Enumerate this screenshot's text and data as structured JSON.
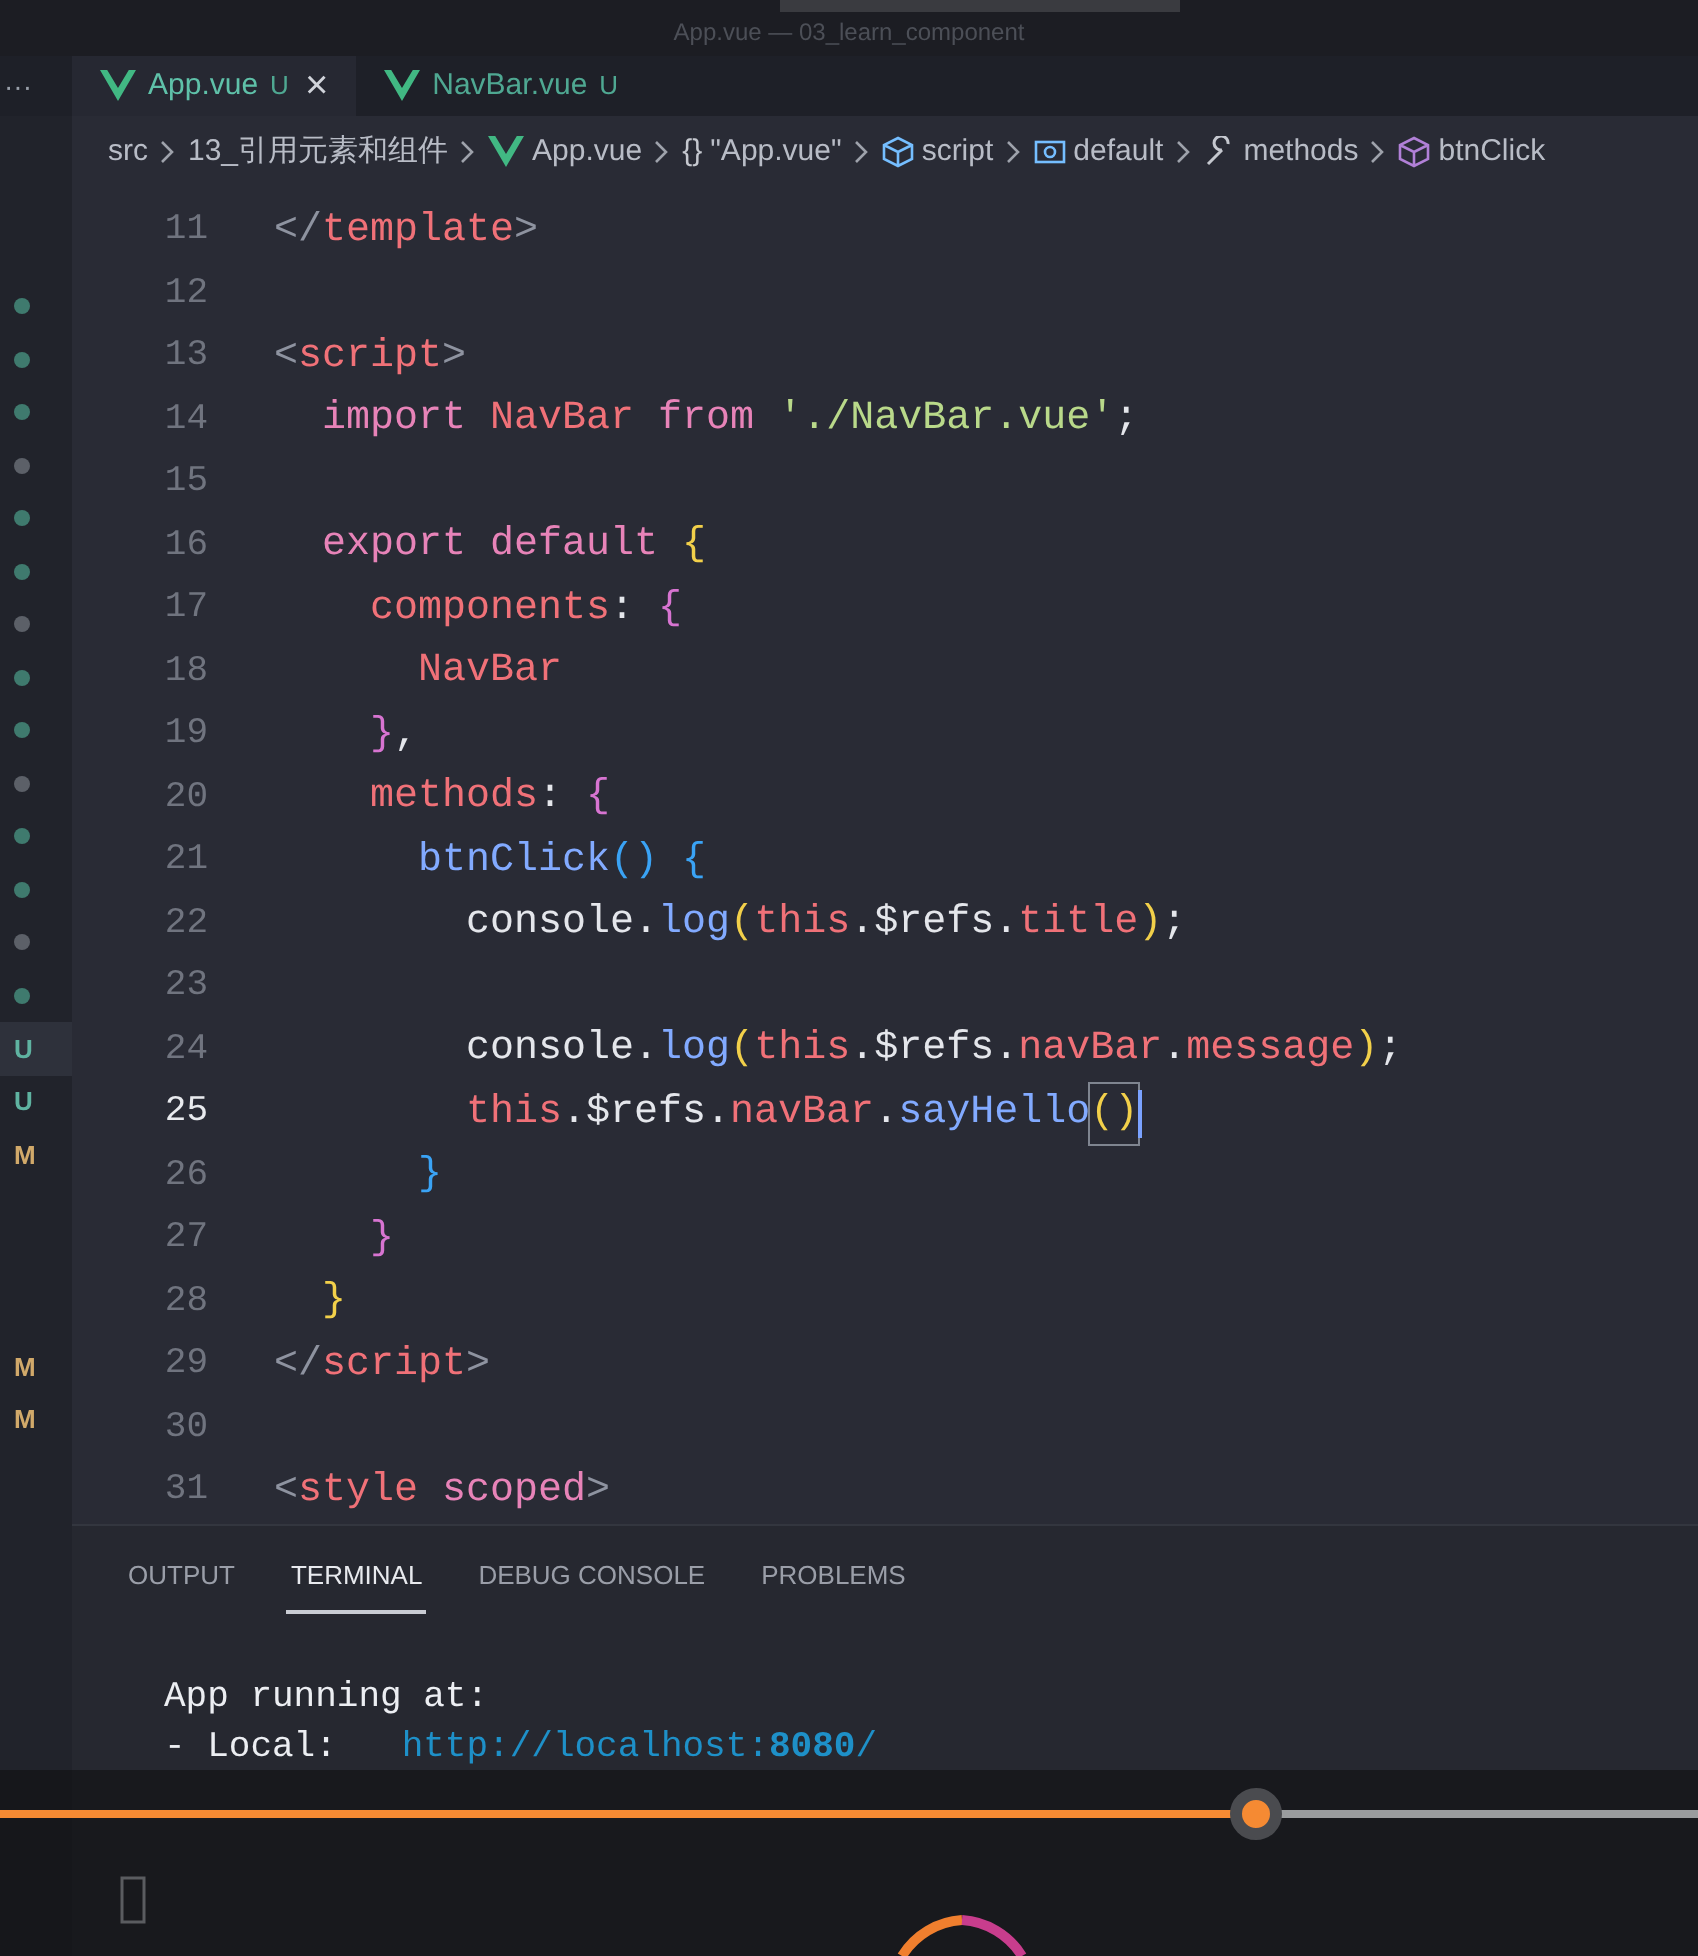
{
  "window": {
    "title": "App.vue — 03_learn_component"
  },
  "sidebar": {
    "more": "···",
    "decorations": [
      {
        "kind": "dot",
        "color": "#3f7a6e"
      },
      {
        "kind": "dot",
        "color": "#3f7a6e"
      },
      {
        "kind": "dot",
        "color": "#3f7a6e"
      },
      {
        "kind": "dot",
        "color": "#5c6068"
      },
      {
        "kind": "dot",
        "color": "#3f7a6e"
      },
      {
        "kind": "dot",
        "color": "#3f7a6e"
      },
      {
        "kind": "dot",
        "color": "#5c6068"
      },
      {
        "kind": "dot",
        "color": "#3f7a6e"
      },
      {
        "kind": "dot",
        "color": "#3f7a6e"
      },
      {
        "kind": "dot",
        "color": "#5c6068"
      },
      {
        "kind": "dot",
        "color": "#3f7a6e"
      },
      {
        "kind": "dot",
        "color": "#3f7a6e"
      },
      {
        "kind": "dot",
        "color": "#5c6068"
      },
      {
        "kind": "dot",
        "color": "#3f7a6e"
      },
      {
        "kind": "letter",
        "text": "U",
        "color": "#5fb3a1",
        "selected": true
      },
      {
        "kind": "letter",
        "text": "U",
        "color": "#5fb3a1",
        "selected": false
      },
      {
        "kind": "letter",
        "text": "M",
        "color": "#d1a96a",
        "selected": false
      },
      {
        "kind": "blank"
      },
      {
        "kind": "blank"
      },
      {
        "kind": "blank"
      },
      {
        "kind": "letter",
        "text": "M",
        "color": "#d1a96a",
        "selected": false
      },
      {
        "kind": "letter",
        "text": "M",
        "color": "#d1a96a",
        "selected": false
      }
    ]
  },
  "tabs": [
    {
      "label": "App.vue",
      "status": "U",
      "selected": true,
      "close": "×"
    },
    {
      "label": "NavBar.vue",
      "status": "U",
      "selected": false
    }
  ],
  "breadcrumb": [
    {
      "kind": "folder",
      "label": "src"
    },
    {
      "kind": "folder",
      "label": "13_引用元素和组件"
    },
    {
      "kind": "vue",
      "label": "App.vue"
    },
    {
      "kind": "module",
      "glyph": "{}",
      "label": "\"App.vue\""
    },
    {
      "kind": "script",
      "label": "script"
    },
    {
      "kind": "variable",
      "label": "default"
    },
    {
      "kind": "method",
      "label": "methods"
    },
    {
      "kind": "function",
      "label": "btnClick"
    }
  ],
  "editor": {
    "lines": [
      {
        "number": "11",
        "current": false,
        "tokens": [
          {
            "text": "</",
            "kind": "punct"
          },
          {
            "text": "template",
            "kind": "tag"
          },
          {
            "text": ">",
            "kind": "punct"
          }
        ]
      },
      {
        "number": "12",
        "current": false
      },
      {
        "number": "13",
        "current": false,
        "tokens": [
          {
            "text": "<",
            "kind": "punct"
          },
          {
            "text": "script",
            "kind": "tag"
          },
          {
            "text": ">",
            "kind": "punct"
          }
        ]
      },
      {
        "number": "14",
        "current": false,
        "tokens": [
          {
            "text": "  import ",
            "kind": "kw"
          },
          {
            "text": "NavBar ",
            "kind": "ident"
          },
          {
            "text": "from ",
            "kind": "kw"
          },
          {
            "text": "'./NavBar.vue'",
            "kind": "str"
          },
          {
            "text": ";",
            "kind": "plain"
          }
        ]
      },
      {
        "number": "15",
        "current": false
      },
      {
        "number": "16",
        "current": false,
        "tokens": [
          {
            "text": "  export default ",
            "kind": "kw"
          },
          {
            "text": "{",
            "kind": "b1"
          }
        ]
      },
      {
        "number": "17",
        "current": false,
        "tokens": [
          {
            "text": "    components",
            "kind": "ident"
          },
          {
            "text": ": ",
            "kind": "plain"
          },
          {
            "text": "{",
            "kind": "b2"
          }
        ]
      },
      {
        "number": "18",
        "current": false,
        "tokens": [
          {
            "text": "      NavBar",
            "kind": "ident"
          }
        ]
      },
      {
        "number": "19",
        "current": false,
        "tokens": [
          {
            "text": "    }",
            "kind": "b2"
          },
          {
            "text": ",",
            "kind": "plain"
          }
        ]
      },
      {
        "number": "20",
        "current": false,
        "tokens": [
          {
            "text": "    methods",
            "kind": "ident"
          },
          {
            "text": ": ",
            "kind": "plain"
          },
          {
            "text": "{",
            "kind": "b2"
          }
        ]
      },
      {
        "number": "21",
        "current": false,
        "tokens": [
          {
            "text": "      btnClick",
            "kind": "fn"
          },
          {
            "text": "() {",
            "kind": "b3"
          }
        ]
      },
      {
        "number": "22",
        "current": false,
        "tokens": [
          {
            "text": "        console.",
            "kind": "plain"
          },
          {
            "text": "log",
            "kind": "fn"
          },
          {
            "text": "(",
            "kind": "b1"
          },
          {
            "text": "this",
            "kind": "ident"
          },
          {
            "text": ".$refs.",
            "kind": "plain"
          },
          {
            "text": "title",
            "kind": "ident"
          },
          {
            "text": ")",
            "kind": "b1"
          },
          {
            "text": ";",
            "kind": "plain"
          }
        ]
      },
      {
        "number": "23",
        "current": false
      },
      {
        "number": "24",
        "current": false,
        "tokens": [
          {
            "text": "        console.",
            "kind": "plain"
          },
          {
            "text": "log",
            "kind": "fn"
          },
          {
            "text": "(",
            "kind": "b1"
          },
          {
            "text": "this",
            "kind": "ident"
          },
          {
            "text": ".$refs.",
            "kind": "plain"
          },
          {
            "text": "navBar",
            "kind": "ident"
          },
          {
            "text": ".",
            "kind": "plain"
          },
          {
            "text": "message",
            "kind": "ident"
          },
          {
            "text": ")",
            "kind": "b1"
          },
          {
            "text": ";",
            "kind": "plain"
          }
        ]
      },
      {
        "number": "25",
        "current": true,
        "tokens": [
          {
            "text": "        this",
            "kind": "ident"
          },
          {
            "text": ".$refs.",
            "kind": "plain"
          },
          {
            "text": "navBar",
            "kind": "ident"
          },
          {
            "text": ".",
            "kind": "plain"
          },
          {
            "text": "sayHello",
            "kind": "fn"
          },
          {
            "text": "()",
            "kind": "match"
          }
        ]
      },
      {
        "number": "26",
        "current": false,
        "tokens": [
          {
            "text": "      }",
            "kind": "b3"
          }
        ]
      },
      {
        "number": "27",
        "current": false,
        "tokens": [
          {
            "text": "    }",
            "kind": "b2"
          }
        ]
      },
      {
        "number": "28",
        "current": false,
        "tokens": [
          {
            "text": "  }",
            "kind": "b1"
          }
        ]
      },
      {
        "number": "29",
        "current": false,
        "tokens": [
          {
            "text": "</",
            "kind": "punct"
          },
          {
            "text": "script",
            "kind": "tag"
          },
          {
            "text": ">",
            "kind": "punct"
          }
        ]
      },
      {
        "number": "30",
        "current": false
      },
      {
        "number": "31",
        "current": false,
        "tokens": [
          {
            "text": "<",
            "kind": "punct"
          },
          {
            "text": "style ",
            "kind": "tag"
          },
          {
            "text": "scoped",
            "kind": "kw"
          },
          {
            "text": ">",
            "kind": "punct"
          }
        ]
      }
    ]
  },
  "panel": {
    "tabs": [
      {
        "label": "OUTPUT",
        "selected": false
      },
      {
        "label": "TERMINAL",
        "selected": true
      },
      {
        "label": "DEBUG CONSOLE",
        "selected": false
      },
      {
        "label": "PROBLEMS",
        "selected": false
      }
    ],
    "terminal": [
      [
        {
          "text": "App running at:",
          "kind": "text"
        }
      ],
      [
        {
          "text": "- Local:   ",
          "kind": "text"
        },
        {
          "text": "http://localhost:",
          "kind": "link"
        },
        {
          "text": "8080",
          "kind": "linkbold"
        },
        {
          "text": "/",
          "kind": "link"
        }
      ]
    ]
  },
  "player": {
    "progress": {
      "level": 0.74
    }
  }
}
